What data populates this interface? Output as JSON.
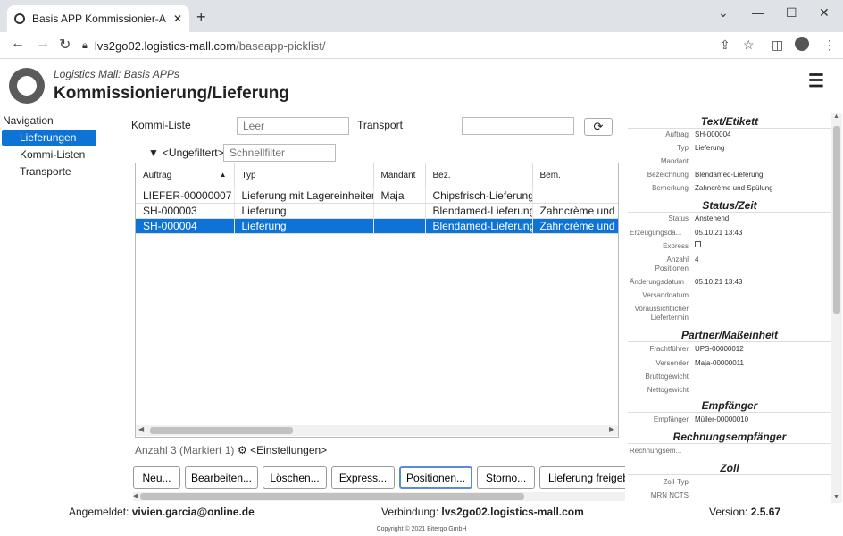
{
  "browser": {
    "tab_title": "Basis APP Kommissionier-Auftrag",
    "url_host": "lvs2go02.logistics-mall.com",
    "url_path": "/baseapp-picklist/"
  },
  "header": {
    "subtitle": "Logistics Mall: Basis APPs",
    "title": "Kommissionierung/Lieferung"
  },
  "nav": {
    "heading": "Navigation",
    "items": [
      "Lieferungen",
      "Kommi-Listen",
      "Transporte"
    ]
  },
  "filters": {
    "kommi_label": "Kommi-Liste",
    "kommi_placeholder": "Leer",
    "transport_label": "Transport",
    "unfiltered": "<Ungefiltert>",
    "quick_placeholder": "Schnellfilter"
  },
  "grid": {
    "columns": [
      "Auftrag",
      "Typ",
      "Mandant",
      "Bez.",
      "Bem."
    ],
    "rows": [
      [
        "LIEFER-00000007",
        "Lieferung mit Lagereinheiten",
        "Maja",
        "Chipsfrisch-Lieferung",
        ""
      ],
      [
        "SH-000003",
        "Lieferung",
        "",
        "Blendamed-Lieferung",
        "Zahncrème und Spülung"
      ],
      [
        "SH-000004",
        "Lieferung",
        "",
        "Blendamed-Lieferung",
        "Zahncrème und Spülung"
      ]
    ],
    "selected_row": 2,
    "count_label": "Anzahl 3 (Markiert 1)",
    "settings_label": "<Einstellungen>"
  },
  "buttons": [
    "Neu...",
    "Bearbeiten...",
    "Löschen...",
    "Express...",
    "Positionen...",
    "Storno...",
    "Lieferung freigebe"
  ],
  "panel": {
    "sections": {
      "text": "Text/Etikett",
      "status": "Status/Zeit",
      "partner": "Partner/Maßeinheit",
      "empfaenger": "Empfänger",
      "rechnung": "Rechnungsempfänger",
      "zoll": "Zoll"
    },
    "fields": {
      "auftrag": {
        "label": "Auftrag",
        "value": "SH-000004"
      },
      "typ": {
        "label": "Typ",
        "value": "Lieferung"
      },
      "mandant": {
        "label": "Mandant",
        "value": ""
      },
      "bezeichnung": {
        "label": "Bezeichnung",
        "value": "Blendamed-Lieferung"
      },
      "bemerkung": {
        "label": "Bemerkung",
        "value": "Zahncrème und Spülung"
      },
      "status": {
        "label": "Status",
        "value": "Anstehend"
      },
      "erzeugung": {
        "label": "Erzeugungsda...",
        "value": "05.10.21 13:43"
      },
      "express": {
        "label": "Express",
        "value": ""
      },
      "anzahl_label1": "Anzahl",
      "anzahl_label2": "Positionen",
      "anzahl_value": "4",
      "aenderung": {
        "label": "Änderungsdatum",
        "value": "05.10.21 13:43"
      },
      "versand": {
        "label": "Versanddatum",
        "value": ""
      },
      "voraus_label1": "Voraussichtlicher",
      "voraus_label2": "Liefertermin",
      "frachtfuehrer": {
        "label": "Frachtführer",
        "value": "UPS-00000012"
      },
      "versender": {
        "label": "Versender",
        "value": "Maja-00000011"
      },
      "brutto": {
        "label": "Bruttogewicht",
        "value": ""
      },
      "netto": {
        "label": "Nettogewicht",
        "value": ""
      },
      "empfaenger": {
        "label": "Empfänger",
        "value": "Müller-00000010"
      },
      "rechnungsemp": {
        "label": "Rechnungsem...",
        "value": ""
      },
      "zolltyp": {
        "label": "Zoll-Typ",
        "value": ""
      },
      "mrn": {
        "label": "MRN NCTS",
        "value": ""
      }
    }
  },
  "footer": {
    "login_label": "Angemeldet:",
    "login_user": "vivien.garcia@online.de",
    "conn_label": "Verbindung:",
    "conn_host": "lvs2go02.logistics-mall.com",
    "version_label": "Version:",
    "version": "2.5.67",
    "copyright": "Copyright © 2021 Bitergo GmbH"
  },
  "colors": {
    "accent": "#0d73d6"
  }
}
